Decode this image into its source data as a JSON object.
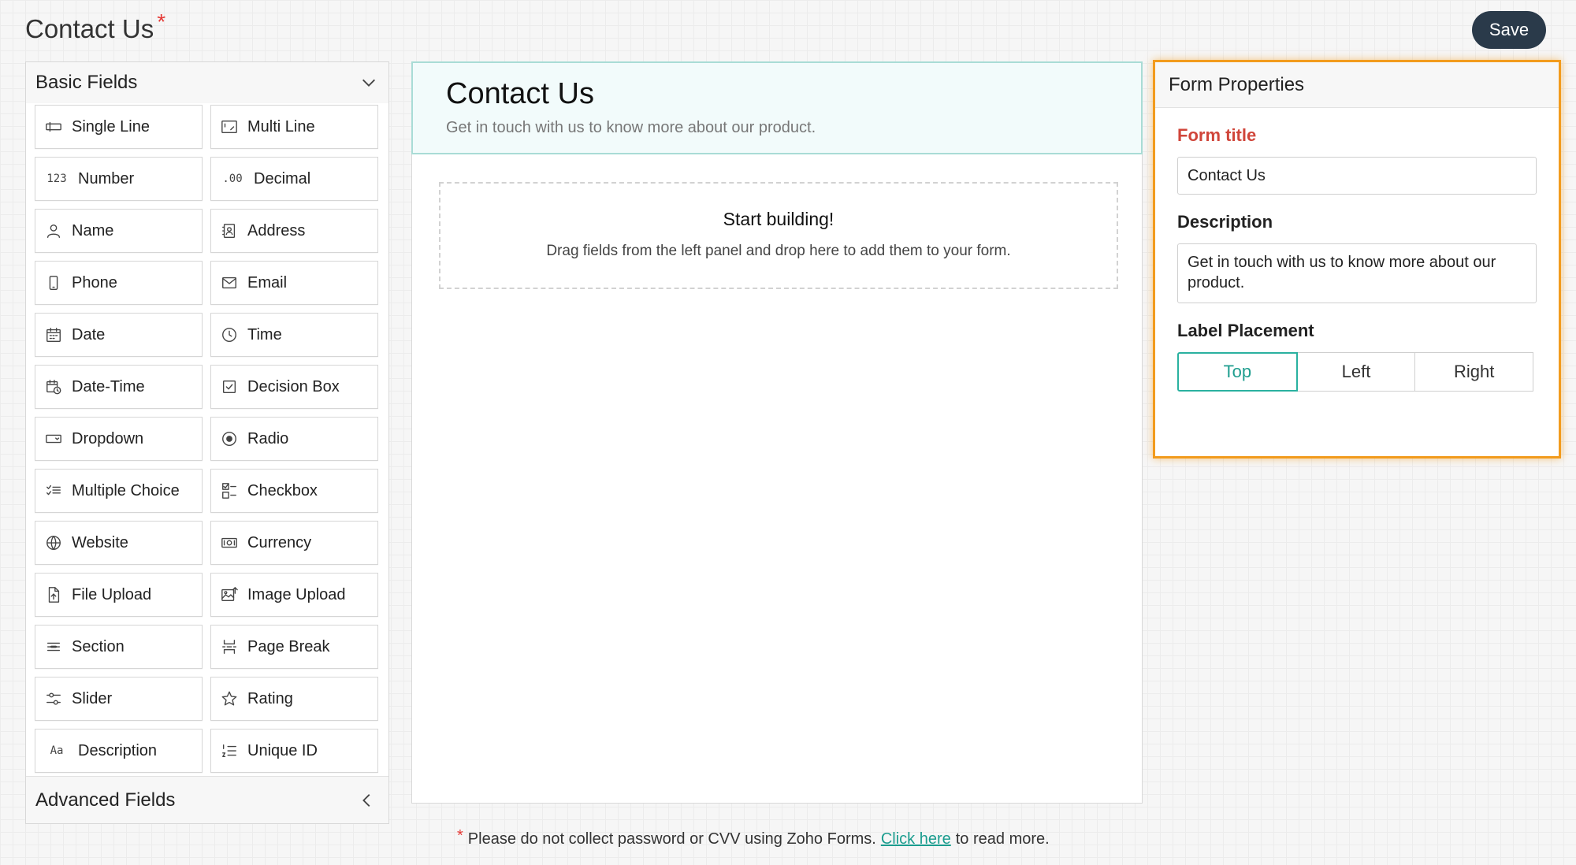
{
  "page": {
    "title": "Contact Us",
    "required_mark": "*",
    "save_label": "Save"
  },
  "left_panel": {
    "basic_title": "Basic Fields",
    "advanced_title": "Advanced Fields",
    "fields": [
      {
        "label": "Single Line",
        "icon": "single-line-icon"
      },
      {
        "label": "Multi Line",
        "icon": "multi-line-icon"
      },
      {
        "label": "Number",
        "icon": "number-icon",
        "glyph": "123"
      },
      {
        "label": "Decimal",
        "icon": "decimal-icon",
        "glyph": ".00"
      },
      {
        "label": "Name",
        "icon": "user-icon"
      },
      {
        "label": "Address",
        "icon": "address-book-icon"
      },
      {
        "label": "Phone",
        "icon": "phone-icon"
      },
      {
        "label": "Email",
        "icon": "envelope-icon"
      },
      {
        "label": "Date",
        "icon": "calendar-icon"
      },
      {
        "label": "Time",
        "icon": "clock-icon"
      },
      {
        "label": "Date-Time",
        "icon": "calendar-clock-icon"
      },
      {
        "label": "Decision Box",
        "icon": "checked-box-icon"
      },
      {
        "label": "Dropdown",
        "icon": "dropdown-icon"
      },
      {
        "label": "Radio",
        "icon": "radio-icon"
      },
      {
        "label": "Multiple Choice",
        "icon": "multiple-choice-icon"
      },
      {
        "label": "Checkbox",
        "icon": "checkbox-list-icon"
      },
      {
        "label": "Website",
        "icon": "globe-icon"
      },
      {
        "label": "Currency",
        "icon": "currency-icon"
      },
      {
        "label": "File Upload",
        "icon": "file-upload-icon"
      },
      {
        "label": "Image Upload",
        "icon": "image-upload-icon"
      },
      {
        "label": "Section",
        "icon": "section-icon"
      },
      {
        "label": "Page Break",
        "icon": "page-break-icon"
      },
      {
        "label": "Slider",
        "icon": "slider-icon"
      },
      {
        "label": "Rating",
        "icon": "star-icon"
      },
      {
        "label": "Description",
        "icon": "text-description-icon",
        "glyph": "Aa"
      },
      {
        "label": "Unique ID",
        "icon": "unique-id-icon"
      }
    ]
  },
  "form": {
    "title": "Contact Us",
    "description": "Get in touch with us to know more about our product.",
    "drop_title": "Start building!",
    "drop_hint": "Drag fields from the left panel and drop here to add them to your form."
  },
  "footer": {
    "mark": "*",
    "text_before": "Please do not collect password or CVV using Zoho Forms.",
    "link": "Click here",
    "text_after": "to read more."
  },
  "properties": {
    "header": "Form Properties",
    "form_title_label": "Form title",
    "form_title_value": "Contact Us",
    "description_label": "Description",
    "description_value": "Get in touch with us to know more about our product.",
    "label_placement_label": "Label Placement",
    "placements": [
      "Top",
      "Left",
      "Right"
    ],
    "selected_placement": "Top"
  },
  "colors": {
    "accent": "#2ab1a0",
    "highlight": "#f29b1d",
    "save_bg": "#2a3a4a",
    "required": "#e53935"
  }
}
